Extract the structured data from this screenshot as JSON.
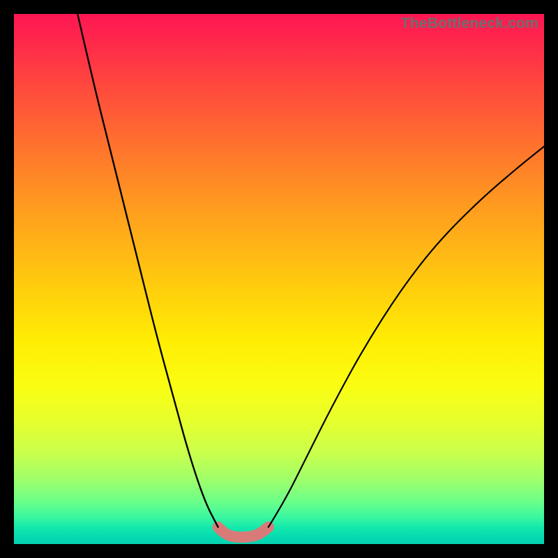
{
  "watermark": "TheBottleneck.com",
  "chart_data": {
    "type": "line",
    "title": "",
    "xlabel": "",
    "ylabel": "",
    "xlim": [
      0,
      100
    ],
    "ylim": [
      0,
      100
    ],
    "series": [
      {
        "name": "left-branch",
        "x": [
          12,
          15,
          18,
          21,
          24,
          27,
          30,
          33,
          36,
          38.5
        ],
        "y": [
          100,
          87,
          75,
          63,
          51,
          39,
          28,
          17,
          8,
          3.2
        ],
        "color": "#000000"
      },
      {
        "name": "right-branch",
        "x": [
          48,
          51,
          55,
          60,
          66,
          73,
          80,
          88,
          95,
          100
        ],
        "y": [
          3.2,
          8,
          16,
          26,
          37,
          48,
          57,
          65,
          71,
          75
        ],
        "color": "#000000"
      },
      {
        "name": "flat-bottom-highlight",
        "x": [
          38.5,
          40,
          43,
          46,
          48
        ],
        "y": [
          3.2,
          1.6,
          1.2,
          1.6,
          3.2
        ],
        "color": "#d87b78",
        "stroke_width": 16
      }
    ],
    "background_gradient": {
      "direction": "top-to-bottom",
      "stops": [
        {
          "pos": 0,
          "color": "#ff1653"
        },
        {
          "pos": 24,
          "color": "#ff6f2f"
        },
        {
          "pos": 54,
          "color": "#ffd50a"
        },
        {
          "pos": 77,
          "color": "#e6ff2e"
        },
        {
          "pos": 92,
          "color": "#6bff89"
        },
        {
          "pos": 100,
          "color": "#03d2b1"
        }
      ]
    }
  }
}
